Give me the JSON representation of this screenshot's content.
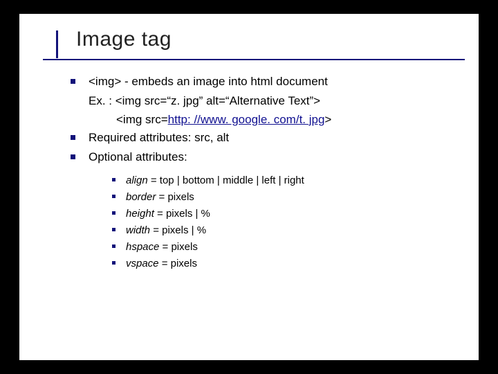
{
  "title": "Image tag",
  "bullets": [
    {
      "lead": "<img> - embeds an image into html document",
      "ex_label": "Ex. : <img src=“z. jpg” alt=“Alternative Text”>",
      "ex2_pre": "<img src=",
      "ex2_link": "http: //www. google. com/t. jpg",
      "ex2_post": ">"
    },
    {
      "text": "Required attributes: src, alt"
    },
    {
      "text": "Optional attributes:"
    }
  ],
  "opts": [
    {
      "name": "align",
      "vals": " = top | bottom | middle | left | right"
    },
    {
      "name": "border",
      "vals": " = pixels"
    },
    {
      "name": "height",
      "vals": " = pixels | %"
    },
    {
      "name": "width",
      "vals": " = pixels | %"
    },
    {
      "name": "hspace",
      "vals": " = pixels"
    },
    {
      "name": "vspace",
      "vals": " = pixels"
    }
  ]
}
